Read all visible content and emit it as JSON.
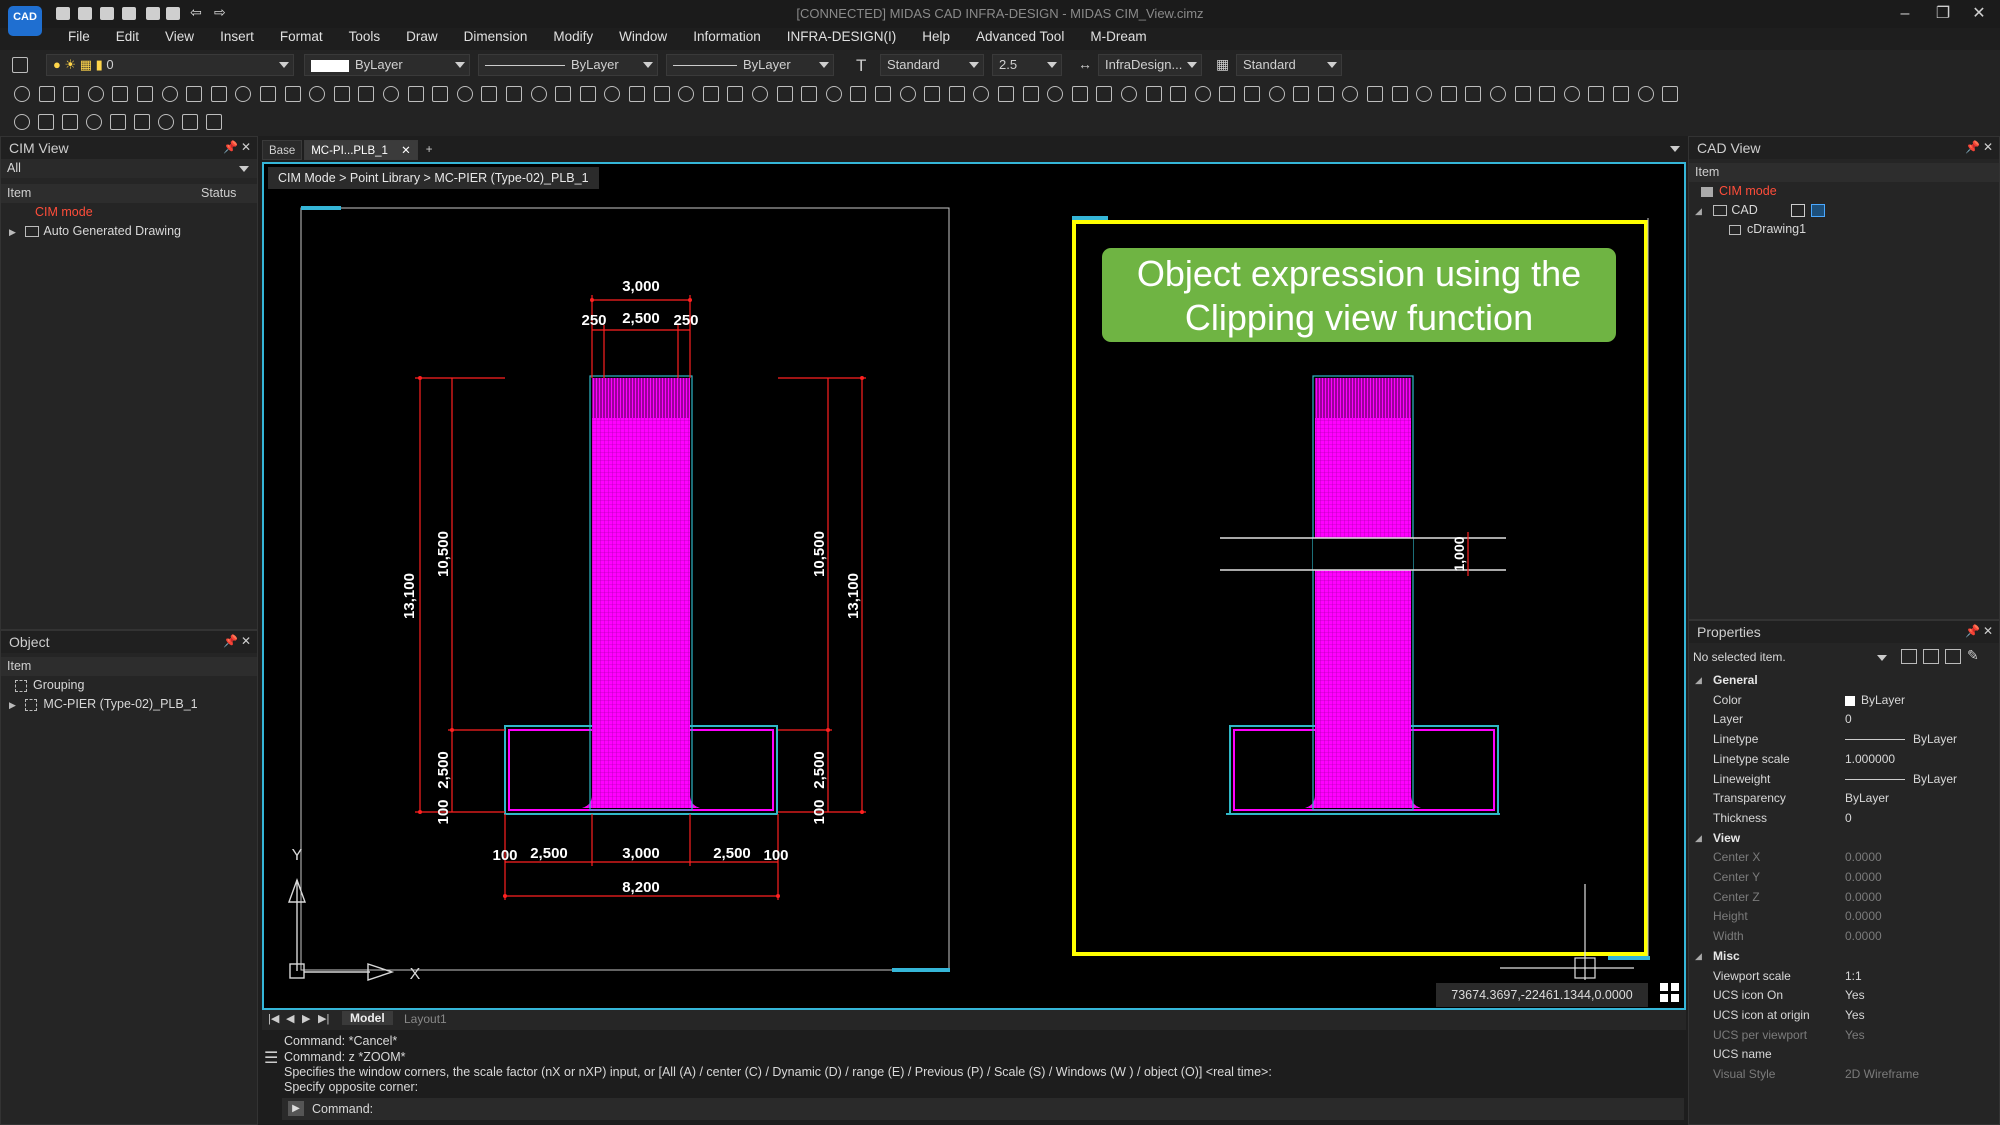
{
  "app": {
    "logo": "CAD",
    "title": "[CONNECTED] MIDAS CAD INFRA-DESIGN - MIDAS CIM_View.cimz"
  },
  "menu": [
    "File",
    "Edit",
    "View",
    "Insert",
    "Format",
    "Tools",
    "Draw",
    "Dimension",
    "Modify",
    "Window",
    "Information",
    "INFRA-DESIGN(I)",
    "Help",
    "Advanced Tool",
    "M-Dream"
  ],
  "toolbar1": {
    "layer_value": "0",
    "color_value": "ByLayer",
    "linetype_value": "ByLayer",
    "lineweight_value": "ByLayer",
    "text_style": "Standard",
    "text_height": "2.5",
    "dim_style": "InfraDesign...",
    "table_style": "Standard"
  },
  "cim_view": {
    "title": "CIM View",
    "filter": "All",
    "col_item": "Item",
    "col_status": "Status",
    "items": [
      "CIM mode",
      "Auto Generated Drawing"
    ]
  },
  "object_panel": {
    "title": "Object",
    "col_item": "Item",
    "items": [
      "Grouping",
      "MC-PIER (Type-02)_PLB_1"
    ]
  },
  "tabs": [
    "Base",
    "MC-PI...PLB_1",
    "+"
  ],
  "breadcrumb": "CIM Mode > Point Library > MC-PIER (Type-02)_PLB_1",
  "callout": {
    "line1": "Object expression using the",
    "line2": "Clipping view function"
  },
  "drawing_left": {
    "dims_top": [
      "3,000",
      "250",
      "2,500",
      "250"
    ],
    "dims_left": [
      "13,100",
      "10,500",
      "2,500",
      "100"
    ],
    "dims_right": [
      "10,500",
      "13,100",
      "2,500",
      "100"
    ],
    "dims_bottom": [
      "100",
      "2,500",
      "3,000",
      "2,500",
      "100",
      "8,200"
    ],
    "axis_x": "X",
    "axis_y": "Y"
  },
  "drawing_right": {
    "dim_clip": "1,000"
  },
  "coords": "73674.3697,-22461.1344,0.0000",
  "layout_tabs": [
    "Model",
    "Layout1"
  ],
  "command": {
    "lines": [
      "Command: *Cancel*",
      "Command: z *ZOOM*",
      "Specifies the window corners, the scale factor (nX or nXP) input, or [All (A) / center (C) / Dynamic (D) / range (E) / Previous (P) / Scale (S) / Windows (W ) / object (O)] <real time>:",
      "Specify opposite corner:"
    ],
    "prompt": "Command:"
  },
  "cad_view": {
    "title": "CAD View",
    "col_item": "Item",
    "items": [
      "CIM mode",
      "CAD",
      "cDrawing1"
    ]
  },
  "properties": {
    "title": "Properties",
    "selection": "No selected item.",
    "groups": [
      {
        "name": "General",
        "rows": [
          {
            "k": "Color",
            "v": "ByLayer"
          },
          {
            "k": "Layer",
            "v": "0"
          },
          {
            "k": "Linetype",
            "v": "ByLayer"
          },
          {
            "k": "Linetype scale",
            "v": "1.000000"
          },
          {
            "k": "Lineweight",
            "v": "ByLayer"
          },
          {
            "k": "Transparency",
            "v": "ByLayer"
          },
          {
            "k": "Thickness",
            "v": "0"
          }
        ]
      },
      {
        "name": "View",
        "rows": [
          {
            "k": "Center X",
            "v": "0.0000"
          },
          {
            "k": "Center Y",
            "v": "0.0000"
          },
          {
            "k": "Center Z",
            "v": "0.0000"
          },
          {
            "k": "Height",
            "v": "0.0000"
          },
          {
            "k": "Width",
            "v": "0.0000"
          }
        ]
      },
      {
        "name": "Misc",
        "rows": [
          {
            "k": "Viewport scale",
            "v": "1:1"
          },
          {
            "k": "UCS icon On",
            "v": "Yes"
          },
          {
            "k": "UCS icon at origin",
            "v": "Yes"
          },
          {
            "k": "UCS per viewport",
            "v": "Yes"
          },
          {
            "k": "UCS name",
            "v": ""
          },
          {
            "k": "Visual Style",
            "v": "2D Wireframe"
          }
        ]
      }
    ]
  },
  "colors": {
    "accent": "#35b6d8",
    "magenta": "#ff00ff",
    "dim_red": "#ff2020",
    "clip_yellow": "#ffff00",
    "callout_green": "#6fb443"
  }
}
